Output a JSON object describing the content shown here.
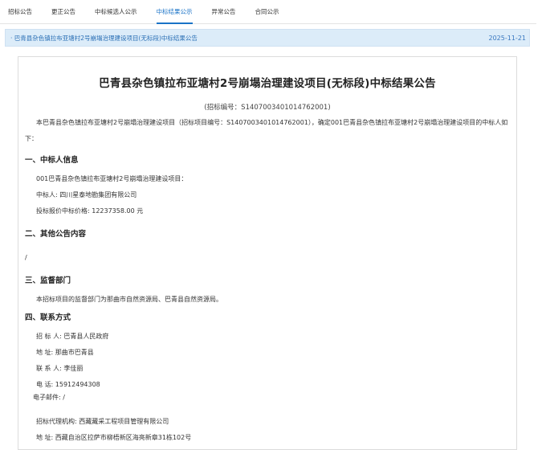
{
  "tabs": [
    "招标公告",
    "更正公告",
    "中标候选人公示",
    "中标结果公示",
    "异常公告",
    "合同公示"
  ],
  "active_tab": "中标结果公示",
  "notice": {
    "link_text": "巴青县杂色镇拉布亚塘村2号崩塌治理建设项目(无标段)中标结果公告",
    "date": "2025-11-21"
  },
  "document": {
    "title": "巴青县杂色镇拉布亚塘村2号崩塌治理建设项目(无标段)中标结果公告",
    "code": "(招标编号：S1407003401014762001)",
    "intro": "本巴青县杂色镇拉布亚塘村2号崩塌治理建设项目（招标项目编号：S1407003401014762001），确定001巴青县杂色镇拉布亚塘村2号崩塌治理建设项目的中标人如下：",
    "sections": {
      "winner_heading": "一、中标人信息",
      "winner_lines": [
        "001巴青县杂色镇拉布亚塘村2号崩塌治理建设项目：",
        "中标人: 四川星泰地勘集团有限公司",
        "投标报价中标价格: 12237358.00 元"
      ],
      "other_heading": "二、其他公告内容",
      "other_content": "/",
      "supervise_heading": "三、监督部门",
      "supervise_content": "本招标项目的监督部门为那曲市自然资源局、巴青县自然资源局。",
      "contact_heading": "四、联系方式",
      "contact_lines": [
        "招 标 人: 巴青县人民政府",
        "地 址: 那曲市巴青县",
        "联 系 人: 李佳丽",
        "电 话: 15912494308"
      ],
      "email_line": "电子邮件: /",
      "agency_lines": [
        "招标代理机构: 西藏藏采工程项目管理有限公司",
        "地 址: 西藏自治区拉萨市柳梧新区海亮新章31栋102号"
      ]
    }
  },
  "colors": {
    "accent": "#1a73c7",
    "notice_bg": "#dcecf9"
  }
}
